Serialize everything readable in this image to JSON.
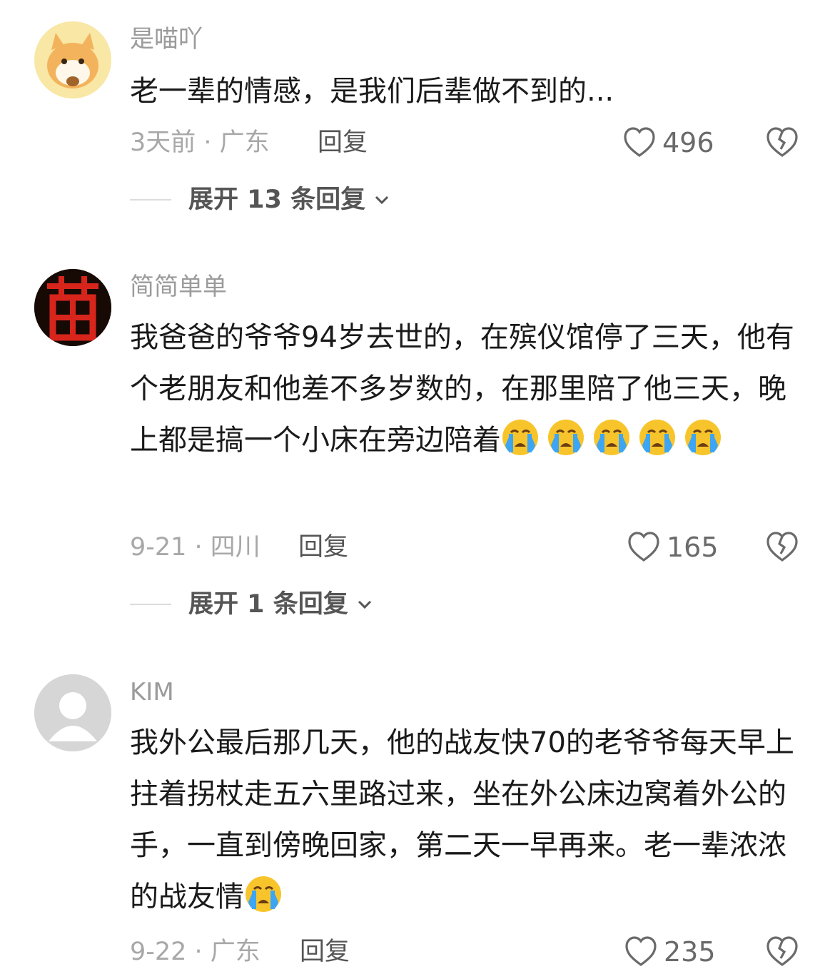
{
  "comments": [
    {
      "username": "是喵吖",
      "text": "老一辈的情感，是我们后辈做不到的...",
      "meta": "3天前 · 广东",
      "reply_label": "回复",
      "likes": "496",
      "expand_label": "展开 13 条回复",
      "emoji_count": 0
    },
    {
      "username": "简简单单",
      "text": "我爸爸的爷爷94岁去世的，在殡仪馆停了三天，他有个老朋友和他差不多岁数的，在那里陪了他三天，晚上都是搞一个小床在旁边陪着",
      "meta": "9-21 · 四川",
      "reply_label": "回复",
      "likes": "165",
      "expand_label": "展开 1 条回复",
      "emoji_count": 5
    },
    {
      "username": "KIM",
      "text": "我外公最后那几天，他的战友快70的老爷爷每天早上拄着拐杖走五六里路过来，坐在外公床边窝着外公的手，一直到傍晚回家，第二天一早再来。老一辈浓浓的战友情",
      "meta": "9-22 · 广东",
      "reply_label": "回复",
      "likes": "235",
      "emoji_count": 1
    }
  ],
  "icons": {
    "emoji": "loudly-crying-face-emoji",
    "like": "heart-outline-icon",
    "dislike": "broken-heart-icon",
    "expand": "chevron-down-icon"
  },
  "colors": {
    "username": "#9b9b9b",
    "text": "#1a1a1a",
    "meta": "#a8a8a8",
    "emoji_face": "#f7c52b",
    "emoji_tears": "#3da5f4"
  }
}
